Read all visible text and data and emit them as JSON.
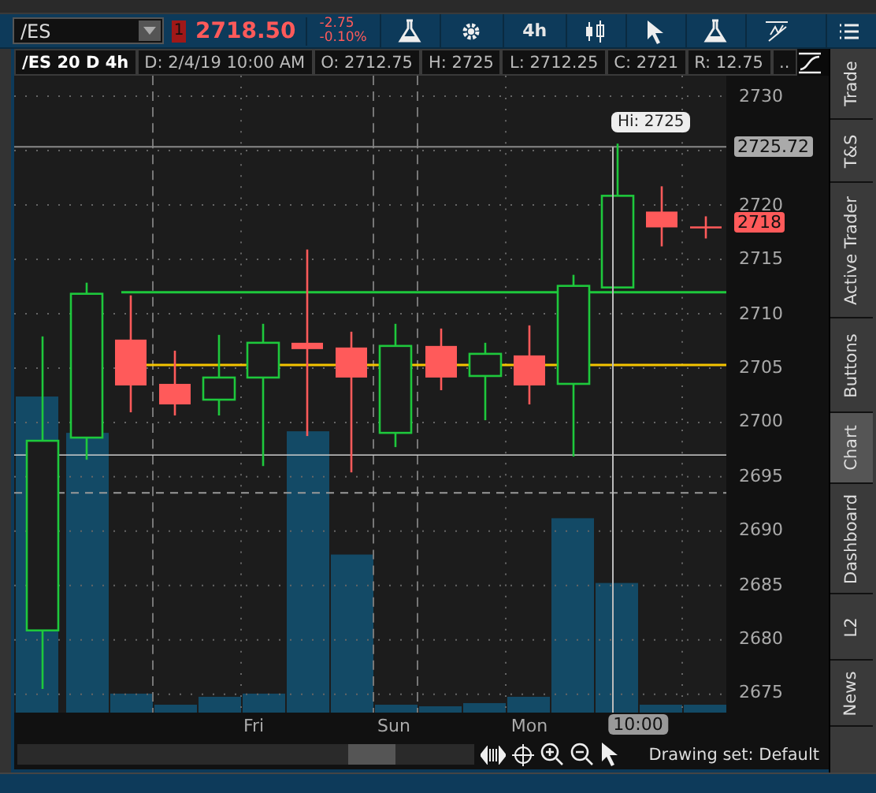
{
  "toolbar": {
    "symbol": "/ES",
    "account_badge": "1",
    "last_price": "2718.50",
    "net_change": "-2.75",
    "percent_change": "-0.10%",
    "aggregation": "4h"
  },
  "info_bar": [
    "/ES 20 D 4h",
    "D: 2/4/19 10:00 AM",
    "O: 2712.75",
    "H: 2725",
    "L: 2712.25",
    "C: 2721",
    "R: 12.75",
    ".."
  ],
  "chart": {
    "price_ticks": [
      "2730",
      "2720",
      "2715",
      "2710",
      "2705",
      "2700",
      "2695",
      "2690",
      "2685",
      "2680",
      "2675"
    ],
    "high_bubble": "Hi: 2725",
    "cursor_price": "2725.72",
    "last_price_badge": "2718",
    "time_labels": [
      "Fri",
      "Sun",
      "Mon"
    ],
    "cursor_time": "10:00"
  },
  "side_tabs": [
    {
      "label": "Trade",
      "selected": false
    },
    {
      "label": "T&S",
      "selected": false
    },
    {
      "label": "Active Trader",
      "selected": false
    },
    {
      "label": "Buttons",
      "selected": false
    },
    {
      "label": "Chart",
      "selected": true
    },
    {
      "label": "Dashboard",
      "selected": false
    },
    {
      "label": "L2",
      "selected": false
    },
    {
      "label": "News",
      "selected": false
    }
  ],
  "drawing_set": "Drawing set: Default"
}
